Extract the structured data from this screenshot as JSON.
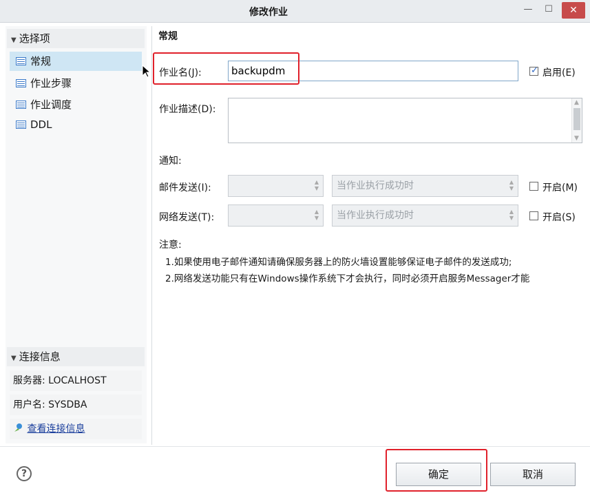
{
  "window": {
    "title": "修改作业",
    "minimize": "—",
    "maximize": "☐",
    "close": "✕"
  },
  "sidebar": {
    "section_title": "选择项",
    "items": [
      {
        "label": "常规",
        "selected": true
      },
      {
        "label": "作业步骤",
        "selected": false
      },
      {
        "label": "作业调度",
        "selected": false
      },
      {
        "label": "DDL",
        "selected": false
      }
    ],
    "connection": {
      "title": "连接信息",
      "server": "服务器: LOCALHOST",
      "user": "用户名: SYSDBA",
      "view_link": "查看连接信息"
    }
  },
  "main": {
    "heading": "常规",
    "job_name_label": "作业名(J):",
    "job_name_value": "backupdm",
    "enable_label": "启用(E)",
    "enable_checked": true,
    "description_label": "作业描述(D):",
    "description_value": "",
    "notify_label": "通知:",
    "email_label": "邮件发送(I):",
    "email_operator": "",
    "email_condition": "当作业执行成功时",
    "email_enable_label": "开启(M)",
    "net_label": "网络发送(T):",
    "net_operator": "",
    "net_condition": "当作业执行成功时",
    "net_enable_label": "开启(S)",
    "note_title": "注意:",
    "note_1": "1.如果使用电子邮件通知请确保服务器上的防火墙设置能够保证电子邮件的发送成功;",
    "note_2": "2.网络发送功能只有在Windows操作系统下才会执行，同时必须开启服务Messager才能"
  },
  "footer": {
    "help": "?",
    "ok": "确定",
    "cancel": "取消"
  },
  "colors": {
    "highlight_box": "#e0202a",
    "selection": "#cfe6f4",
    "link": "#1a3e9c"
  }
}
